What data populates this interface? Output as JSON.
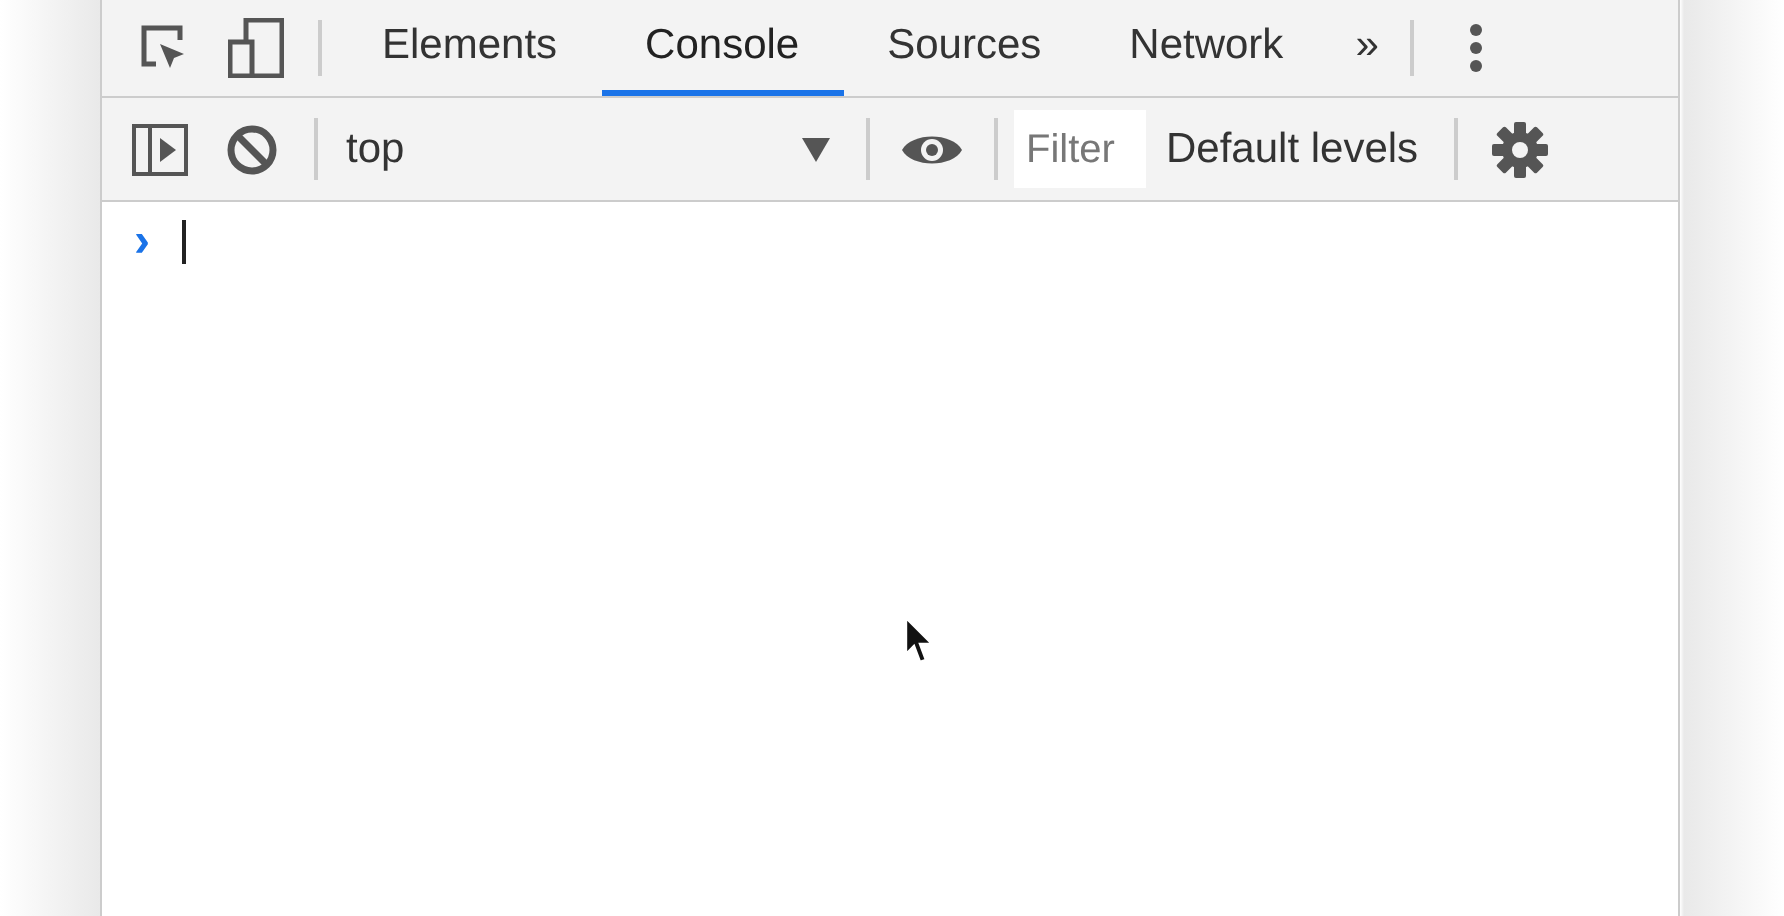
{
  "tabs": [
    {
      "label": "Elements",
      "selected": false
    },
    {
      "label": "Console",
      "selected": true
    },
    {
      "label": "Sources",
      "selected": false
    },
    {
      "label": "Network",
      "selected": false
    }
  ],
  "more_tabs": "»",
  "context": {
    "value": "top"
  },
  "filter": {
    "placeholder": "Filter"
  },
  "levels": {
    "label": "Default levels"
  },
  "prompt": "›"
}
